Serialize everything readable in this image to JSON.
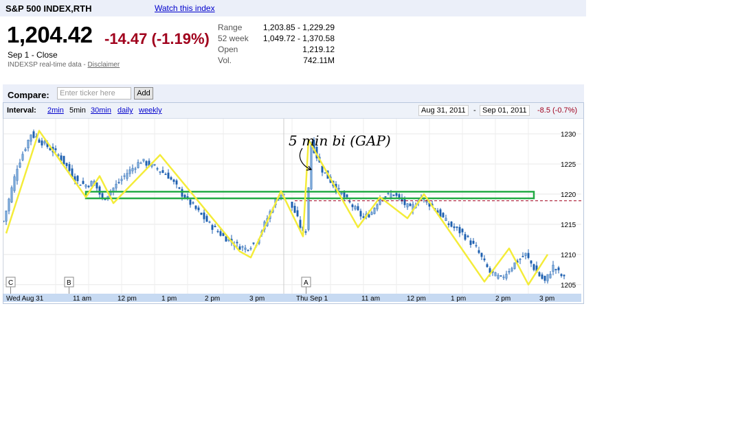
{
  "header": {
    "title": "S&P 500 INDEX,RTH",
    "watch_link": "Watch this index",
    "price": "1,204.42",
    "change": "-14.47 (-1.19%)",
    "close_label": "Sep 1 - Close",
    "realtime_text": "INDEXSP real-time data - ",
    "disclaimer": "Disclaimer"
  },
  "stats": [
    {
      "label": "Range",
      "value": "1,203.85 - 1,229.29"
    },
    {
      "label": "52 week",
      "value": "1,049.72 - 1,370.58"
    },
    {
      "label": "Open",
      "value": "1,219.12"
    },
    {
      "label": "Vol.",
      "value": "742.11M"
    }
  ],
  "compare": {
    "label": "Compare:",
    "placeholder": "Enter ticker here",
    "add_label": "Add"
  },
  "interval": {
    "label": "Interval:",
    "options": [
      {
        "label": "2min",
        "selected": false
      },
      {
        "label": "5min",
        "selected": true
      },
      {
        "label": "30min",
        "selected": false
      },
      {
        "label": "daily",
        "selected": false
      },
      {
        "label": "weekly",
        "selected": false
      }
    ],
    "date_from": "Aug 31, 2011",
    "date_sep": "-",
    "date_to": "Sep 01, 2011",
    "range_change": "-8.5 (-0.7%)"
  },
  "colors": {
    "up": "#7aa8d8",
    "down": "#1d5fb0",
    "annotation": "#f4ec3a",
    "box": "#22aa44",
    "prev_close": "#a0001c"
  },
  "chart_data": {
    "type": "candlestick",
    "ylim": [
      1203.5,
      1232.5
    ],
    "yticks": [
      1205,
      1210,
      1215,
      1220,
      1225,
      1230
    ],
    "x_labels": [
      "Wed Aug 31",
      "11 am",
      "12 pm",
      "1 pm",
      "2 pm",
      "3 pm",
      "Thu Sep 1",
      "11 am",
      "12 pm",
      "1 pm",
      "2 pm",
      "3 pm"
    ],
    "markers": [
      "C",
      "B",
      "A"
    ],
    "prev_close": 1218.9,
    "close_path": [
      [
        0,
        1215.5
      ],
      [
        5,
        1224.5
      ],
      [
        10,
        1230
      ],
      [
        20,
        1226.5
      ],
      [
        27,
        1222
      ],
      [
        30,
        1221.5
      ],
      [
        33,
        1222
      ],
      [
        36,
        1219
      ],
      [
        40,
        1221
      ],
      [
        45,
        1223.5
      ],
      [
        50,
        1225.5
      ],
      [
        55,
        1224.5
      ],
      [
        60,
        1223
      ],
      [
        65,
        1220
      ],
      [
        70,
        1217.5
      ],
      [
        75,
        1215
      ],
      [
        80,
        1213
      ],
      [
        85,
        1211.5
      ],
      [
        88,
        1211
      ],
      [
        92,
        1212
      ],
      [
        95,
        1215
      ],
      [
        99,
        1219
      ],
      [
        101,
        1220
      ],
      [
        103,
        1219.5
      ],
      [
        106,
        1217
      ],
      [
        109,
        1213.5
      ],
      [
        110,
        1214
      ],
      [
        112,
        1228.5
      ],
      [
        116,
        1224
      ],
      [
        121,
        1221
      ],
      [
        125,
        1219
      ],
      [
        131,
        1216
      ],
      [
        134,
        1217
      ],
      [
        137,
        1219.5
      ],
      [
        142,
        1220
      ],
      [
        148,
        1217.5
      ],
      [
        152,
        1219.5
      ],
      [
        156,
        1218
      ],
      [
        162,
        1215
      ],
      [
        167,
        1213.5
      ],
      [
        172,
        1211
      ],
      [
        177,
        1207
      ],
      [
        181,
        1206
      ],
      [
        186,
        1208.5
      ],
      [
        190,
        1210
      ],
      [
        194,
        1207
      ],
      [
        197,
        1205.5
      ],
      [
        200,
        1208
      ],
      [
        204,
        1206
      ]
    ],
    "annotations": [
      {
        "text": "5 min bi (GAP)"
      }
    ],
    "zigzag": [
      [
        1,
        1213.5
      ],
      [
        13,
        1230.5
      ],
      [
        30,
        1219.5
      ],
      [
        35,
        1223
      ],
      [
        40,
        1218.5
      ],
      [
        57,
        1226.5
      ],
      [
        86,
        1210.5
      ],
      [
        90,
        1209.5
      ],
      [
        101,
        1220.5
      ],
      [
        109,
        1213
      ],
      [
        111,
        1229
      ],
      [
        129,
        1214.5
      ],
      [
        137,
        1219.5
      ],
      [
        147,
        1216
      ],
      [
        153,
        1220
      ],
      [
        175,
        1205.5
      ],
      [
        184,
        1211
      ],
      [
        191,
        1205
      ],
      [
        198,
        1210
      ]
    ],
    "box": {
      "x0": 30,
      "x1": 193,
      "y0": 1219.3,
      "y1": 1220.4
    }
  }
}
